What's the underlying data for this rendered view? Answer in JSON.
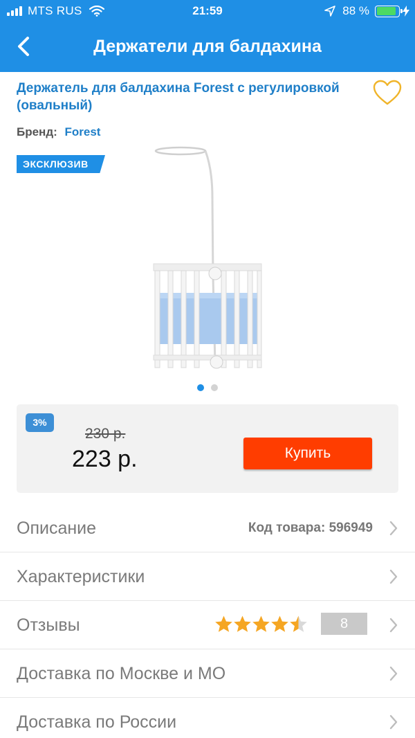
{
  "status_bar": {
    "carrier": "MTS RUS",
    "time": "21:59",
    "battery_percent": "88 %",
    "battery_level": 0.88
  },
  "nav": {
    "title": "Держатели для балдахина",
    "back_icon": "chevron-left-icon"
  },
  "product": {
    "title": "Держатель для балдахина Forest с регулировкой (овальный)",
    "brand_label": "Бренд:",
    "brand": "Forest",
    "badge": "ЭКСКЛЮЗИВ",
    "favorite_icon": "heart-outline-icon",
    "gallery": {
      "total": 2,
      "active": 1
    }
  },
  "price": {
    "discount": "3%",
    "old": "230 р.",
    "current": "223 р.",
    "buy_label": "Купить"
  },
  "rows": {
    "description": {
      "label": "Описание",
      "code": "Код товара: 596949"
    },
    "specs": {
      "label": "Характеристики"
    },
    "reviews": {
      "label": "Отзывы",
      "rating": 4.5,
      "rating_max": 5,
      "count": "8"
    },
    "delivery_moscow": {
      "label": "Доставка по Москве и МО"
    },
    "delivery_russia": {
      "label": "Доставка по России"
    }
  },
  "colors": {
    "brand_blue": "#1f8fe5",
    "link_blue": "#1f7fc8",
    "buy_orange": "#ff3d00",
    "star_gold": "#f5a623",
    "heart_gold": "#f0b429"
  }
}
